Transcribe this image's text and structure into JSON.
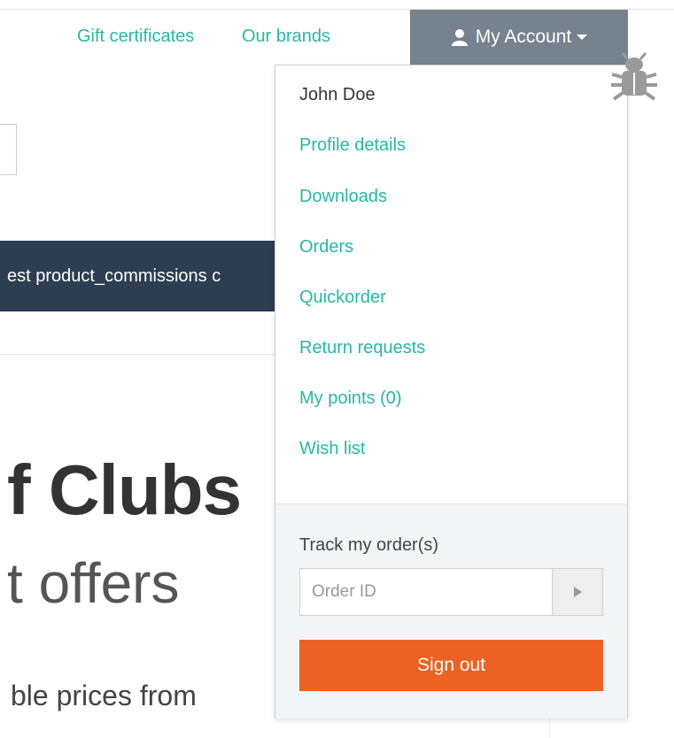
{
  "header": {
    "links": [
      "Gift certificates",
      "Our brands"
    ],
    "account_label": "My Account"
  },
  "banner": {
    "text": "est product_commissions c"
  },
  "hero": {
    "title": "f Clubs",
    "subtitle": "t offers",
    "text": "ble prices from"
  },
  "dropdown": {
    "user_name": "John Doe",
    "links": [
      "Profile details",
      "Downloads",
      "Orders",
      "Quickorder",
      "Return requests",
      "My points (0)",
      "Wish list"
    ],
    "track_label": "Track my order(s)",
    "order_placeholder": "Order ID",
    "sign_out_label": "Sign out"
  },
  "colors": {
    "link": "#28b8a3",
    "account_bg": "#76838f",
    "banner_bg": "#2d3e50",
    "sign_out_bg": "#ec6222"
  },
  "icons": {
    "user": "user-icon",
    "caret": "caret-down-icon",
    "bug": "bug-icon",
    "submit": "play-arrow-icon"
  }
}
